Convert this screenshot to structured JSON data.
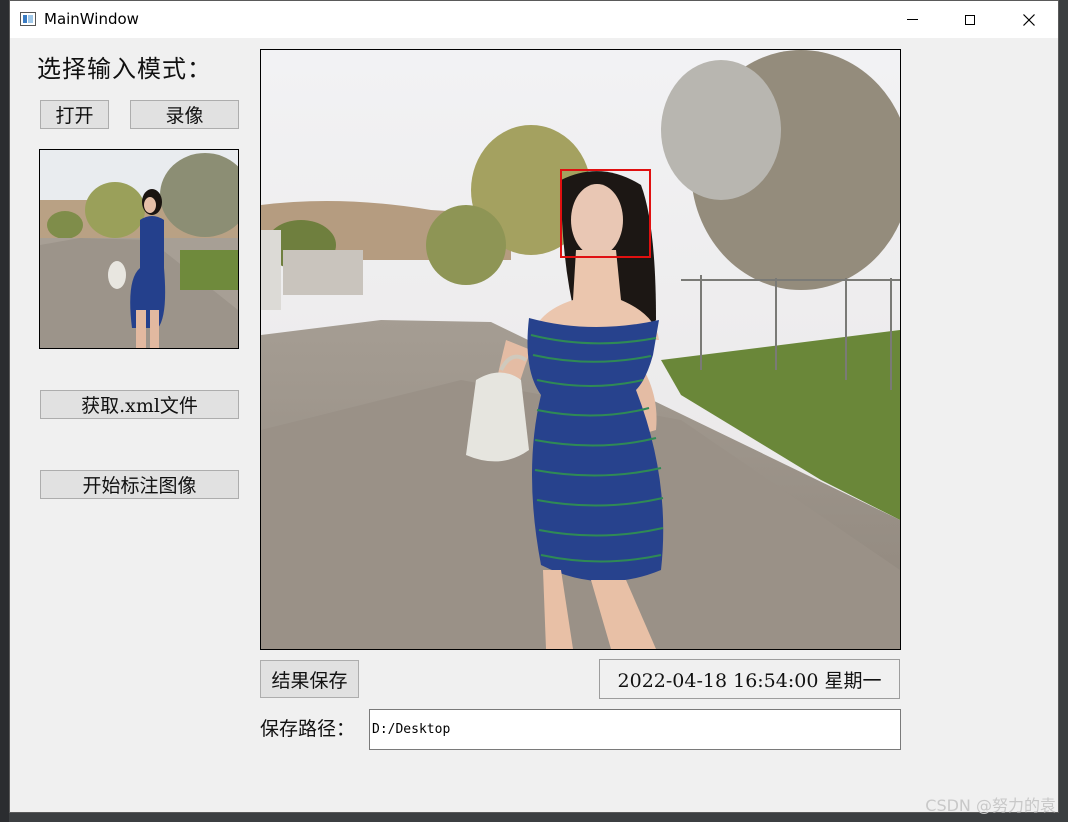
{
  "window": {
    "title": "MainWindow",
    "minimize_icon": "minimize-icon",
    "maximize_icon": "maximize-icon",
    "close_icon": "close-icon"
  },
  "left_panel": {
    "mode_label": "选择输入模式：",
    "open_button": "打开",
    "record_button": "录像",
    "get_xml_button": "获取.xml文件",
    "annotate_button": "开始标注图像"
  },
  "bottom": {
    "save_button": "结果保存",
    "datetime": "2022-04-18 16:54:00 星期一",
    "path_label": "保存路径：",
    "path_value": "D:/Desktop"
  },
  "images": {
    "thumbnail": "photo of woman in striped dress on brick path",
    "main": "photo of woman with detected face box",
    "face_box_color": "#e01010"
  },
  "watermark": "CSDN @努力的袁"
}
